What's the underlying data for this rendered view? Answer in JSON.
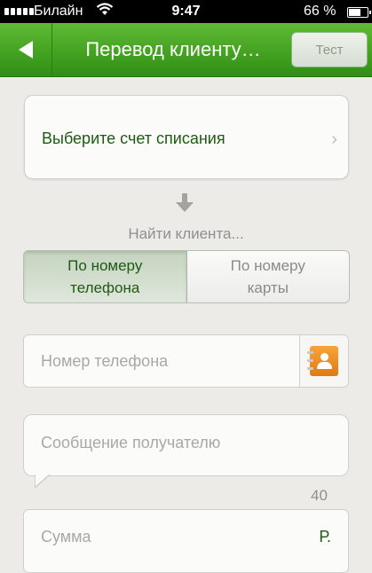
{
  "status_bar": {
    "carrier": "Билайн",
    "time": "9:47",
    "battery_percent": "66 %",
    "battery_level": 0.66
  },
  "navbar": {
    "title": "Перевод клиенту…",
    "test_button": "Тест"
  },
  "account": {
    "label": "Выберите счет списания"
  },
  "find": {
    "label": "Найти клиента..."
  },
  "segments": [
    {
      "line1": "По номеру",
      "line2": "телефона",
      "selected": true
    },
    {
      "line1": "По номеру",
      "line2": "карты",
      "selected": false
    }
  ],
  "phone": {
    "placeholder": "Номер телефона"
  },
  "message": {
    "placeholder": "Сообщение получателю",
    "counter": "40"
  },
  "amount": {
    "placeholder": "Сумма",
    "currency": "Р."
  },
  "colors": {
    "nav_green": "#3fa11f",
    "text_green": "#1f5a12",
    "background": "#ecebe8",
    "contacts_orange": "#f08d22"
  },
  "icons": [
    "signal-icon",
    "wifi-icon",
    "battery-icon",
    "back-arrow-icon",
    "chevron-right-icon",
    "down-arrow-icon",
    "contacts-book-icon"
  ]
}
